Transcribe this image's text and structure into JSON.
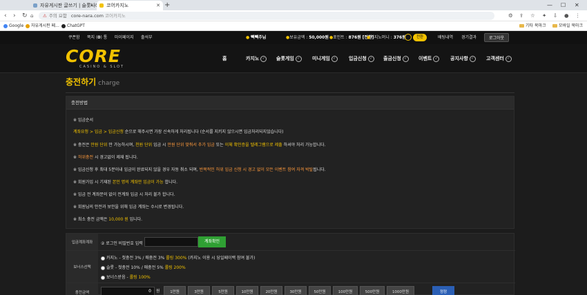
{
  "browser": {
    "tabs": [
      {
        "label": "자유게시판 글쓰기 | 슬롯나라"
      },
      {
        "label": "코어카지노"
      }
    ],
    "url_warning": "주의 요함",
    "url": "core-nara.com",
    "url_sitename": "코어카지노",
    "bookmarks": [
      "Google",
      "자유게시판 페...",
      "ChatGPT"
    ],
    "bookmark_folders": [
      "기타 북마크",
      "모바일 북마크"
    ]
  },
  "sitetop": {
    "links": [
      "쿠폰함",
      "쪽지",
      "마이페이지",
      "출석부"
    ],
    "message_count": "0",
    "message_unit": "통",
    "user": "빽빽주님",
    "balance_label": "보유금액 :",
    "balance_value": "50,000원",
    "points_label": "포인트 :",
    "points_value": "876원 [전환]",
    "casino_money_label": "카지노머니 :",
    "casino_money_value": "376원",
    "convert_btn": "전환",
    "bet_history": "배팅내역",
    "game_results": "경기결과",
    "logout": "로그아웃"
  },
  "logo": {
    "main": "CORE",
    "sub": "CASINO & SLOT"
  },
  "menu": [
    "홈",
    "카지노",
    "슬롯게임",
    "미니게임",
    "입금신청",
    "출금신청",
    "이벤트",
    "공지사항",
    "고객센터"
  ],
  "page": {
    "title": "충전하기",
    "title_en": "charge"
  },
  "panel": {
    "head": "충전방법",
    "notice": "※ 입금순서",
    "steps": "계좌요청 > 입금 > 입금신청",
    "steps_after": " 순으로 해주시면 가장 신속하게 처리됩니다 (순서를 지키지 않으시면 입금처리되지않습니다)",
    "line2a": "※ 충전은 ",
    "line2b": "만원 단위",
    "line2c": " 만 가능하시며, ",
    "line2d": "천원 단위",
    "line2e": " 입금 시 ",
    "line2f": "만원 단위 맞춰서 추가 입금",
    "line2g": " 또는 ",
    "line2h": "이체 확인증을 텔레그램으로 제출",
    "line2i": " 하셔야 처리 가능합니다.",
    "line3a": "※ ",
    "line3b": "허위충전",
    "line3c": " 시 경고없이 제재 됩니다.",
    "line4a": "※ 입금신청 후 최대 5분이내 입금이 완료되지 않을 경우 자동 취소 되며, ",
    "line4b": "반복적인 허위 입금 신청 시 경고 없이 모든 이벤트 참여 자격 박탈",
    "line4c": "됩니다.",
    "line5a": "※ 회원가입 시 기재된 ",
    "line5b": "본인 명의 계좌만 입금이 가능",
    "line5c": " 합니다.",
    "line6": "※ 입금 전 계좌문의 없이 전계좌 입금 시 처리 불가 합니다.",
    "line7": "※ 회원님의 안전과 보안을 위해 입금 계좌는 수시로 변경됩니다.",
    "line8a": "※ 최소 충전 금액은 ",
    "line8b": "10,000 원",
    "line8c": " 입니다."
  },
  "form": {
    "account_label": "입금계좌계좌",
    "pw_prompt": "② 로그인 비밀번호 입력",
    "pw_value": "",
    "check_btn": "계좌확인",
    "bonus_label": "보너스선택",
    "options": [
      {
        "a": "카지노 - 첫충전 3% / 매충전 3% ",
        "b": "롤링 300%",
        "c": " (카지노 이용 시 당일페이백 참여 불가)"
      },
      {
        "a": "슬롯 - 첫충전 10% / 매충전 5% ",
        "b": "롤링 200%",
        "c": ""
      },
      {
        "a": "보너스받음 - ",
        "b": "롤링 100%",
        "c": ""
      }
    ],
    "amount_label": "충전금액",
    "amount_value": "0",
    "amount_unit": "원",
    "amount_buttons": [
      "1만원",
      "3만원",
      "5만원",
      "10만원",
      "20만원",
      "30만원",
      "50만원",
      "100만원",
      "500만원",
      "1000만원"
    ],
    "reset_btn": "정정"
  },
  "colors": {
    "accent": "#f2c200",
    "green": "#2fa033",
    "blue": "#2b5fb5"
  }
}
